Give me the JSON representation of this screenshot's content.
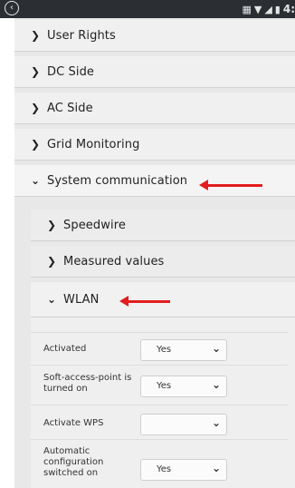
{
  "status_bar": {
    "back_icon": "back-circle-icon",
    "time": "4:"
  },
  "menu": {
    "user_rights": "User Rights",
    "dc_side": "DC Side",
    "ac_side": "AC Side",
    "grid_monitoring": "Grid Monitoring",
    "system_communication": "System communication"
  },
  "system_communication": {
    "speedwire": "Speedwire",
    "measured_values": "Measured values",
    "wlan": "WLAN"
  },
  "wlan": {
    "fields": [
      {
        "label": "Activated",
        "value": "Yes"
      },
      {
        "label": "Soft-access-point is turned on",
        "value": "Yes"
      },
      {
        "label": "Activate WPS",
        "value": ""
      },
      {
        "label": "Automatic configuration switched on",
        "value": "Yes"
      }
    ]
  },
  "annotation_color": "#e21d1d"
}
